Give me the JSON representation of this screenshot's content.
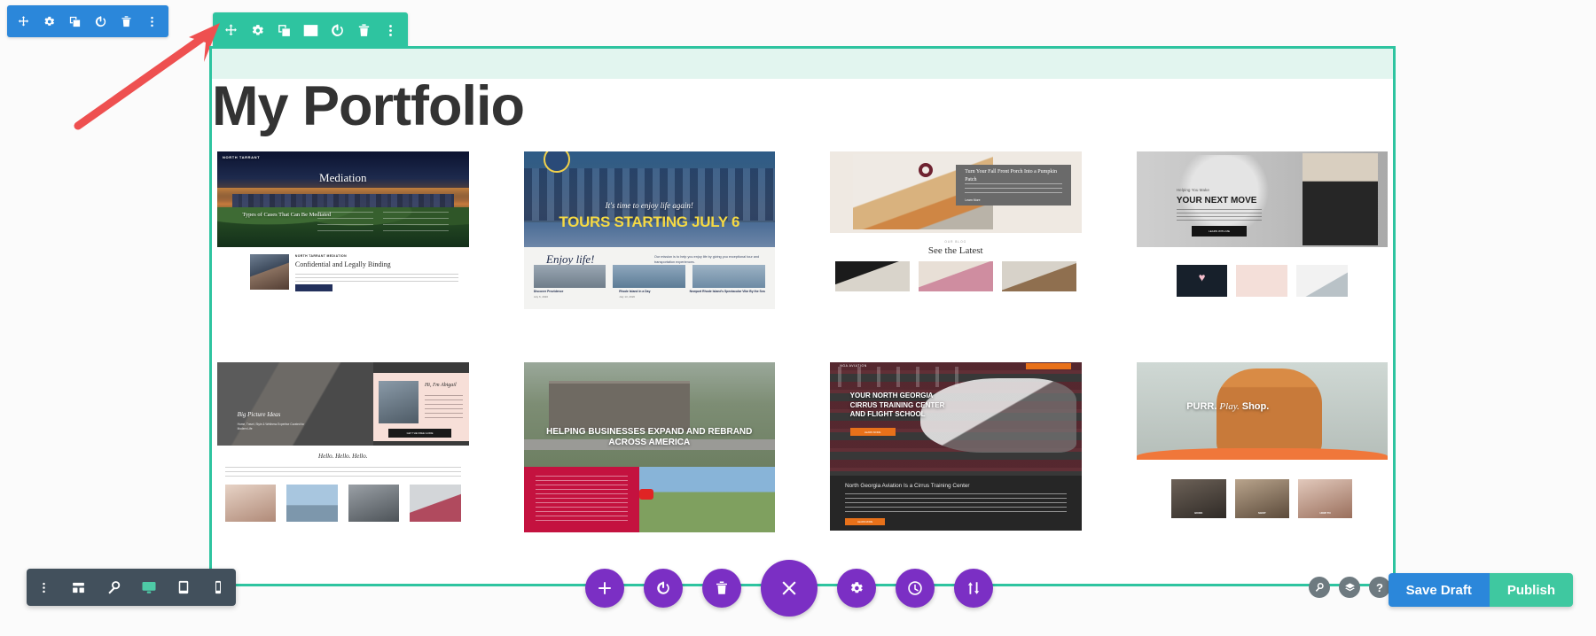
{
  "builder": {
    "section_toolbar": {
      "color": "#2EC4A0",
      "buttons": [
        {
          "name": "move-icon",
          "label": "Move Section"
        },
        {
          "name": "gear-icon",
          "label": "Section Settings"
        },
        {
          "name": "duplicate-icon",
          "label": "Duplicate Section"
        },
        {
          "name": "columns-icon",
          "label": "Column Structure"
        },
        {
          "name": "power-icon",
          "label": "Disable Section"
        },
        {
          "name": "trash-icon",
          "label": "Delete Section"
        },
        {
          "name": "more-options-icon",
          "label": "More Options"
        }
      ]
    },
    "row_toolbar": {
      "color": "#2B87DA",
      "buttons": [
        {
          "name": "move-icon",
          "label": "Move Row"
        },
        {
          "name": "gear-icon",
          "label": "Row Settings"
        },
        {
          "name": "duplicate-icon",
          "label": "Duplicate Row"
        },
        {
          "name": "power-icon",
          "label": "Disable Row"
        },
        {
          "name": "trash-icon",
          "label": "Delete Row"
        },
        {
          "name": "more-options-icon",
          "label": "More Options"
        }
      ]
    },
    "annotation": {
      "name": "red-arrow-pointer",
      "color": "#EE5050"
    }
  },
  "page": {
    "title": "My Portfolio",
    "section_border_color": "#2EC4A0",
    "section_tint_color": "#E2F5EF"
  },
  "portfolio": {
    "items": [
      {
        "id": "mediation",
        "headline": "Mediation",
        "eyebrow": "NORTH TARRANT",
        "sub_headline": "Types of Cases That Can Be Mediated",
        "body_headline": "Confidential and Legally Binding",
        "body_eyebrow": "NORTH TARRANT MEDIATION"
      },
      {
        "id": "tours",
        "script_headline": "It's time to enjoy life again!",
        "headline": "TOURS STARTING JULY 6",
        "body_script": "Enjoy life!",
        "body_text": "Our mission is to help you enjoy life by giving you exceptional tour and transportation experiences.",
        "thumbs": [
          {
            "title": "Discover Providence",
            "date": "July 6, 2020"
          },
          {
            "title": "Rhode Island in a Day",
            "date": "July 13, 2020"
          },
          {
            "title": "Newport Rhode Island's Spectacular Vibe By the Sea",
            "date": ""
          }
        ]
      },
      {
        "id": "pumpkin-porch",
        "card_headline": "Turn Your Fall Front Porch Into a Pumpkin Patch",
        "card_link": "Learn More",
        "body_eyebrow": "OUR BLOG",
        "body_headline": "See the Latest"
      },
      {
        "id": "next-move",
        "eyebrow": "Helping You Make",
        "headline": "YOUR NEXT MOVE",
        "cta": "LEARN WITH ME",
        "thumbs": [
          "heart-photo",
          "yes-we-can-scrabble-photo",
          "notebook-photo"
        ]
      },
      {
        "id": "lifestyle-blog",
        "script_headline": "Big Picture Ideas",
        "sub_headline": "Home, Travel, Style & Wellness Expertise Curated for Modern Life",
        "card_script": "Hi, I'm Abigail",
        "card_cta": "GET THE FREE GUIDE",
        "body_script": "Hello. Hello. Hello.",
        "thumb_count": 4
      },
      {
        "id": "rebrand",
        "headline": "HELPING BUSINESSES EXPAND AND REBRAND ACROSS AMERICA",
        "panel_color": "#C4123F",
        "has_video": true
      },
      {
        "id": "aviation",
        "eyebrow": "NGA AVIATION",
        "headline": "YOUR NORTH GEORGIA CIRRUS TRAINING CENTER AND FLIGHT SCHOOL",
        "cta": "LEARN MORE",
        "body_headline": "North Georgia Aviation Is a Cirrus Training Center",
        "body_cta": "LEARN MORE",
        "accent_color": "#E8711A"
      },
      {
        "id": "cat-cafe",
        "headline_bold": "PURR.",
        "headline_script": "Play.",
        "headline_tail": "Shop.",
        "accent_color": "#F0773A",
        "thumbs": [
          "BOOK",
          "SHOP",
          "HOW TO"
        ]
      }
    ]
  },
  "bottom_left_toolbar": {
    "buttons": [
      {
        "name": "more-options-icon",
        "label": "More Options",
        "active": false
      },
      {
        "name": "wireframe-icon",
        "label": "Wireframe View",
        "active": false
      },
      {
        "name": "zoom-icon",
        "label": "Zoom Out",
        "active": false
      },
      {
        "name": "desktop-icon",
        "label": "Desktop View",
        "active": true
      },
      {
        "name": "tablet-icon",
        "label": "Tablet View",
        "active": false
      },
      {
        "name": "phone-icon",
        "label": "Phone View",
        "active": false
      }
    ]
  },
  "fab_toolbar": {
    "color": "#7B2FC4",
    "buttons": [
      {
        "name": "add-icon",
        "label": "Add New Section"
      },
      {
        "name": "power-icon",
        "label": "Toggle Builder"
      },
      {
        "name": "trash-icon",
        "label": "Clear Layout"
      },
      {
        "name": "close-icon",
        "label": "Close Menu",
        "primary": true
      },
      {
        "name": "gear-icon",
        "label": "Page Settings"
      },
      {
        "name": "history-icon",
        "label": "Editing History"
      },
      {
        "name": "portability-icon",
        "label": "Portability"
      }
    ]
  },
  "bottom_right": {
    "circles": [
      {
        "name": "zoom-icon",
        "label": "Zoom"
      },
      {
        "name": "layers-icon",
        "label": "Layers"
      },
      {
        "name": "help-icon",
        "label": "Help",
        "glyph": "?"
      }
    ],
    "save_draft_label": "Save Draft",
    "publish_label": "Publish",
    "save_draft_color": "#2B87DA",
    "publish_color": "#3FC8A0"
  }
}
